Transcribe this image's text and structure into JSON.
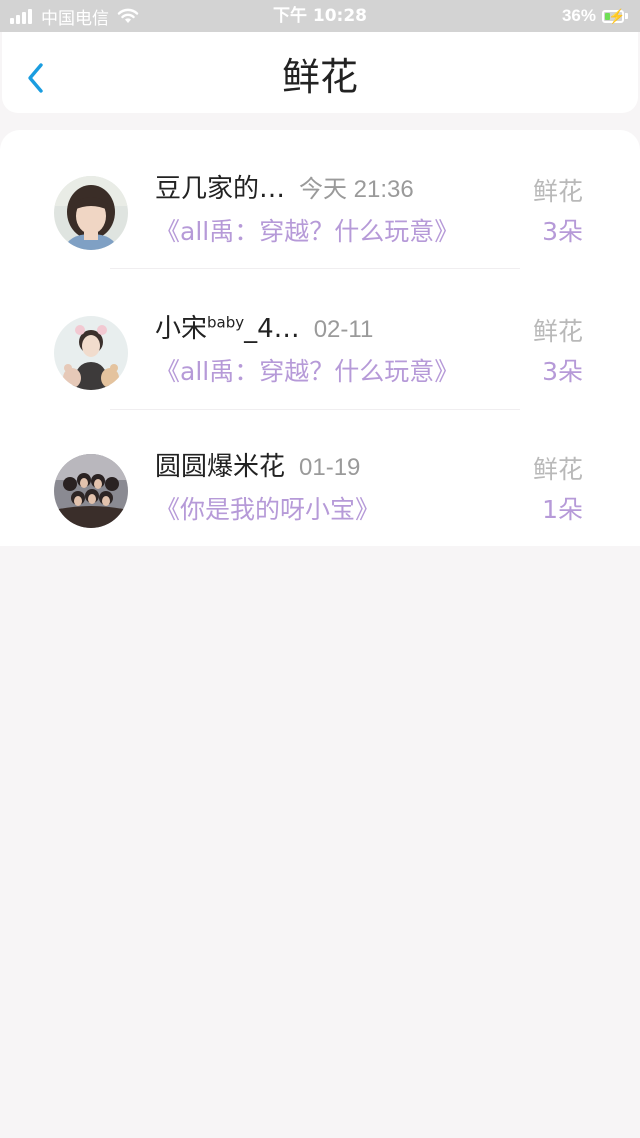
{
  "status_bar": {
    "carrier": "中国电信",
    "time": "下午 10:28",
    "battery": "36%",
    "battery_level": 0.36
  },
  "header": {
    "title": "鲜花"
  },
  "icons": {
    "back": "chevron-left-icon"
  },
  "colors": {
    "accent_blue": "#1a9de0",
    "purple_text": "#b69ad8",
    "gray_text": "#9a9a9a",
    "status_bar_bg": "#d3d3d3"
  },
  "list": [
    {
      "name": "豆几家的…",
      "name_sup": "",
      "name_suffix": "",
      "time": "今天 21:36",
      "book": "《all禹：穿越？什么玩意》",
      "gift_label": "鲜花",
      "gift_count": "3朵"
    },
    {
      "name": "小宋",
      "name_sup": "baby",
      "name_suffix": "_4…",
      "time": "02-11",
      "book": "《all禹：穿越？什么玩意》",
      "gift_label": "鲜花",
      "gift_count": "3朵"
    },
    {
      "name": "圆圆爆米花",
      "name_sup": "",
      "name_suffix": "",
      "time": "01-19",
      "book": "《你是我的呀小宝》",
      "gift_label": "鲜花",
      "gift_count": "1朵"
    }
  ]
}
